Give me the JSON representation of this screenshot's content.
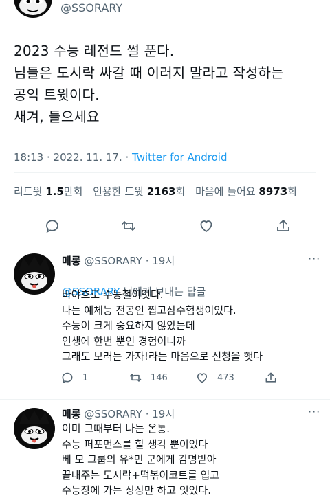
{
  "tweet": {
    "handle": "@SSORARY",
    "text": "2023 수능 레전드 썰 푼다.\n님들은 도시락 싸갈 때 이러지 말라고 작성하는\n공익 트윗이다.\n새겨, 들으세요",
    "time": "18:13 · 2022. 11. 17. · ",
    "source": "Twitter for Android"
  },
  "stats": {
    "retweets_label": "리트윗",
    "retweets_num": "1.5",
    "retweets_unit": "만회",
    "quotes_label": "인용한 트윗",
    "quotes_num": "2163",
    "quotes_unit": "회",
    "likes_label": "마음에 들어요",
    "likes_num": "8973",
    "likes_unit": "회"
  },
  "actions": [
    "reply-icon",
    "retweet-icon",
    "heart-icon",
    "share-icon"
  ],
  "replies": [
    {
      "name": "메롱",
      "handle": "@SSORARY",
      "time": " · 19시",
      "more": "···",
      "reply_to_mention": "@SSORARY",
      "reply_to_suffix": " 님에게 보내는 답글",
      "text": "바야흐로 수능철이엇다.\n나는 예체능 전공인 짭고삼수험생이었다.\n수능이 크게 중요하지 않았는데\n인생에 한번 뿐인 경험이니까\n그래도 보러는 가자!라는 마음으로 신청을 햇다",
      "reply_count": "1",
      "retweet_count": "146",
      "like_count": "473"
    },
    {
      "name": "메롱",
      "handle": "@SSORARY",
      "time": " · 19시",
      "more": "···",
      "text": "이미 그때부터 나는 온통.\n수능 퍼포먼스를 할 생각 뿐이었다\n베 모 그룹의 유*민 군에게 감명받아\n끝내주는 도시락+떡볶이코트를 입고\n수능장에 가는 상상만 하고 잇었다."
    }
  ],
  "colors": {
    "accent": "#1d9bf0",
    "muted": "#536471",
    "text": "#0f1419"
  }
}
